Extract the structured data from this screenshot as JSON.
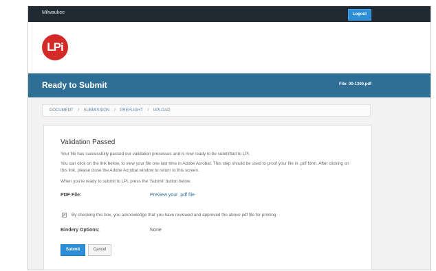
{
  "header": {
    "user_name": "Milwaukee",
    "logout_label": "Logout"
  },
  "logo": {
    "text": "LPi"
  },
  "title_bar": {
    "title": "Ready to Submit",
    "file_label": "File: 00-1300.pdf"
  },
  "breadcrumb": {
    "items": [
      "DOCUMENT",
      "SUBMISSION",
      "PREFLIGHT",
      "UPLOAD"
    ],
    "separator": "/"
  },
  "validation": {
    "title": "Validation Passed",
    "para1": "Your file has successfully passed our validation processes and is now ready to be submitted to LPi.",
    "para2": "You can click on the link below, to view your file one last time in Adobe Acrobat. This step should be used to proof your file in .pdf form. After clicking on this link, please close the Adobe Acrobat window to return to this screen.",
    "para3": "When you're ready to submit to LPi, press the 'Submit' button below.",
    "pdf_file_label": "PDF File:",
    "pdf_file_link": "Preview your .pdf file",
    "checkbox_mark": "✓",
    "checkbox_text": "By checking this box, you acknowledge that you have reviewed and approved the above pdf file for printing",
    "bindery_label": "Bindery Options:",
    "bindery_value": "None",
    "submit_label": "Submit",
    "cancel_label": "Cancel"
  },
  "colors": {
    "topbar": "#1f2a33",
    "title_bar": "#2f6f96",
    "accent": "#2c8fd6",
    "logo": "#d42a27"
  }
}
